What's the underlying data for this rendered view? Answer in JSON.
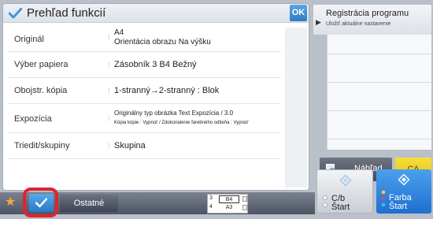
{
  "panel": {
    "title": "Prehľad funkcií",
    "ok_label": "OK",
    "rows": [
      {
        "label": "Originál",
        "value_line1": "A4",
        "value_line2": "Orientácia obrazu Na výšku"
      },
      {
        "label": "Výber papiera",
        "value": "Zásobník 3 B4  Bežný"
      },
      {
        "label": "Obojstr. kópia",
        "value": "1-stranný→2-stranný :  Blok"
      },
      {
        "label": "Expozícia",
        "value_line1": "Originálny typ obrázka Text  Expozícia / 3.0",
        "value_line2": "Kópia kópie : Vypnúť / Zdokonalenie farebného odtieňa : Vypnúť"
      },
      {
        "label": "Triedit/skupiny",
        "value": "Skupina"
      }
    ]
  },
  "registration": {
    "title": "Registrácia programu",
    "subtitle": "Uložiť aktuálne nastavenie"
  },
  "actions": {
    "preview_label": "Náhľad",
    "ca_label": "CA",
    "bw_start_line1": "C/b",
    "bw_start_line2": "Štart",
    "color_start_line1": "Farba",
    "color_start_line2": "Štart"
  },
  "bottom_bar": {
    "others_label": "Ostatné",
    "trays": [
      {
        "number": "3",
        "size": "B4"
      },
      {
        "number": "4",
        "size": "A3"
      }
    ]
  },
  "colors": {
    "accent_blue": "#2d7cc7",
    "ca_yellow": "#f0d22a",
    "highlight_red": "#e0232f",
    "star_orange": "#f4a83a"
  },
  "icons": [
    "check-icon",
    "star-icon",
    "preview-icon",
    "start-diamond-icon",
    "arrow-right-icon"
  ]
}
